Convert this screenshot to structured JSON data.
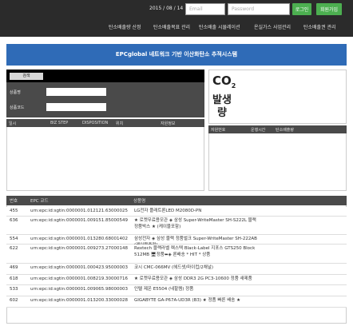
{
  "header": {
    "date": "2015 / 08 / 14",
    "email_placeholder": "Email",
    "password_placeholder": "Password",
    "login_label": "로그인",
    "signup_label": "회원가입",
    "menu": [
      "탄소배출량 산정",
      "탄소배출목표 관리",
      "탄소배출 시뮬레이션",
      "온실가스 사업관리",
      "탄소배출권 관리"
    ]
  },
  "title": "EPCglobal 네트워크 기반 이산화탄소 추적시스템",
  "search": {
    "button_label": "검색",
    "product_name_label": "상품명",
    "product_code_label": "상품코드"
  },
  "event_list": {
    "columns": [
      "일시",
      "BIZ STEP",
      "DISPOSITION",
      "위치",
      "자원정보"
    ]
  },
  "co2_panel": {
    "co2_main": "CO",
    "co2_sub": "2",
    "emission_line1": "발생",
    "emission_line2": "량"
  },
  "emission_list": {
    "columns": [
      "자원번호",
      "운행시간",
      "탄소배출량"
    ]
  },
  "product_table": {
    "columns": [
      "번호",
      "EPC 코드",
      "상품명"
    ],
    "rows": [
      {
        "no": "455",
        "epc": "urn:epc:id:sgtin:0000001.012121.63000025",
        "name": "LG전자 플래트론LED M2080D-PN"
      },
      {
        "no": "636",
        "epc": "urn:epc:id:sgtin:0000001.009151.85000549",
        "name": "★ 로켓무료용모관 ◈ 삼성 Super-WriteMaster SH-S222L 블랙 정품박스 ★ (케이블포함)"
      },
      {
        "no": "554",
        "epc": "urn:epc:id:sgtin:0000001.013280.68001402",
        "name": "삼성전자 ◈ 삼성 블랙 정품벌크 Super-WriteMaster SH-222AB (케이블증정)"
      },
      {
        "no": "622",
        "epc": "urn:epc:id:sgtin:0000001.009273.27000148",
        "name": "Rextech 블랙라벨 렉스텍 Black-Label 지포스 GTS250 Block 512MB 🖥정품⬌◈ 론배송 * HIT * 상품"
      },
      {
        "no": "469",
        "epc": "urn:epc:id:sgtin:0000001.000423.95000003",
        "name": "코시 CMC-066MV (헤드셋/마이컵/2채널)"
      },
      {
        "no": "618",
        "epc": "urn:epc:id:sgtin:0000001.008219.30000716",
        "name": "★ 로켓무료용모관 ◈ 삼성 DDR3 2G PC3-10600 정품 새제품"
      },
      {
        "no": "533",
        "epc": "urn:epc:id:sgtin:0000001.009065.98000003",
        "name": "인텔 제온 E5504 (네할렘) 정품"
      },
      {
        "no": "602",
        "epc": "urn:epc:id:sgtin:0000001.013200.33000028",
        "name": "GIGABYTE GA-P67A-UD3R (B3) ★ 정품 빠른 배송 ★"
      }
    ]
  },
  "colors": {
    "header_bg": "#2b2b2b",
    "title_bg": "#2f6bb7",
    "button_green": "#4caf50",
    "panel_header": "#4a4a4a"
  }
}
